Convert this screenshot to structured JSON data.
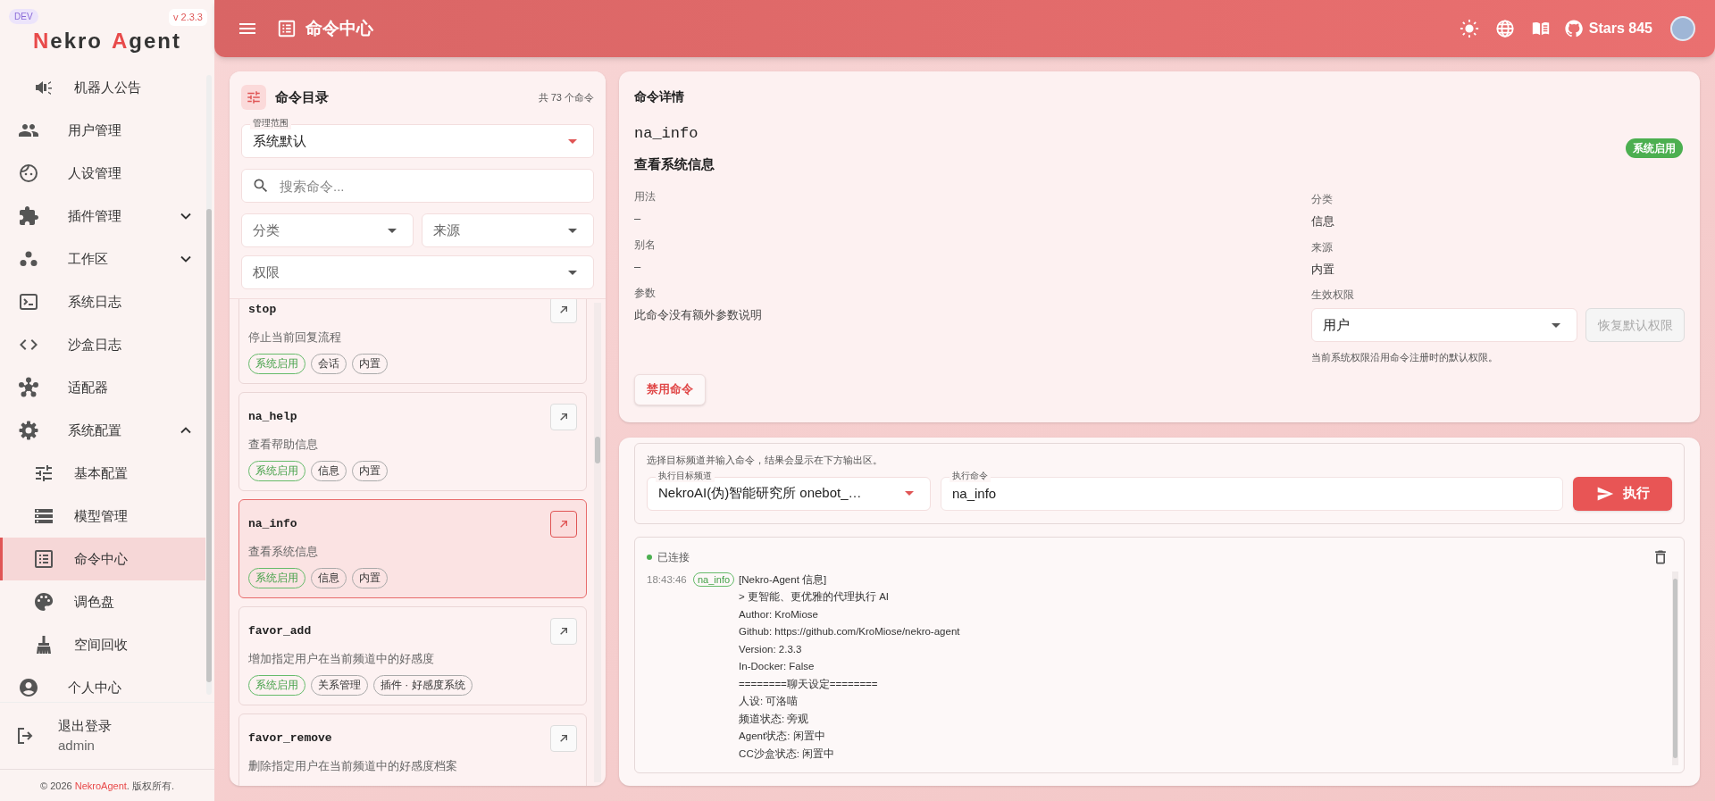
{
  "sidebar": {
    "dev_badge": "DEV",
    "version": "v 2.3.3",
    "logo": [
      {
        "text": "N",
        "accent": true
      },
      {
        "text": "ekro",
        "accent": false
      },
      {
        "text": "A",
        "accent": true
      },
      {
        "text": "gent",
        "accent": false
      }
    ],
    "items": [
      {
        "children": [
          {
            "label": "机器人公告",
            "selected": false
          }
        ]
      },
      {
        "label": "用户管理",
        "selected": false
      },
      {
        "label": "人设管理",
        "selected": false
      },
      {
        "label": "插件管理",
        "selected": false,
        "expanded": false
      },
      {
        "label": "工作区",
        "selected": false,
        "expanded": false
      },
      {
        "label": "系统日志",
        "selected": false
      },
      {
        "label": "沙盒日志",
        "selected": false
      },
      {
        "label": "适配器",
        "selected": false
      },
      {
        "label": "系统配置",
        "selected": false,
        "expanded": true,
        "children": [
          {
            "label": "基本配置",
            "selected": false
          },
          {
            "label": "模型管理",
            "selected": false
          },
          {
            "label": "命令中心",
            "selected": true
          },
          {
            "label": "调色盘",
            "selected": false
          },
          {
            "label": "空间回收",
            "selected": false
          }
        ]
      },
      {
        "label": "个人中心",
        "selected": false
      }
    ],
    "logout": {
      "label": "退出登录",
      "user": "admin"
    },
    "footer": {
      "prefix": "© 2026 ",
      "link": "NekroAgent",
      "suffix": ". 版权所有."
    }
  },
  "header": {
    "title": "命令中心",
    "stars": "Stars 845"
  },
  "catalog": {
    "title": "命令目录",
    "count": "共 73 个命令",
    "scope": {
      "label": "管理范围",
      "value": "系统默认"
    },
    "search": {
      "placeholder": "搜索命令..."
    },
    "filters": [
      {
        "placeholder": "分类"
      },
      {
        "placeholder": "来源"
      },
      {
        "placeholder": "权限"
      }
    ],
    "commands": [
      {
        "name": "stop",
        "description": "停止当前回复流程",
        "selected": false,
        "tags": [
          {
            "label": "系统启用",
            "kind": "status"
          },
          {
            "label": "会话",
            "kind": "meta"
          },
          {
            "label": "内置",
            "kind": "meta"
          }
        ]
      },
      {
        "name": "na_help",
        "description": "查看帮助信息",
        "selected": false,
        "tags": [
          {
            "label": "系统启用",
            "kind": "status"
          },
          {
            "label": "信息",
            "kind": "meta"
          },
          {
            "label": "内置",
            "kind": "meta"
          }
        ]
      },
      {
        "name": "na_info",
        "description": "查看系统信息",
        "selected": true,
        "tags": [
          {
            "label": "系统启用",
            "kind": "status"
          },
          {
            "label": "信息",
            "kind": "meta"
          },
          {
            "label": "内置",
            "kind": "meta"
          }
        ]
      },
      {
        "name": "favor_add",
        "description": "增加指定用户在当前频道中的好感度",
        "selected": false,
        "tags": [
          {
            "label": "系统启用",
            "kind": "status"
          },
          {
            "label": "关系管理",
            "kind": "meta"
          },
          {
            "label": "插件 · 好感度系统",
            "kind": "meta"
          }
        ]
      },
      {
        "name": "favor_remove",
        "description": "删除指定用户在当前频道中的好感度档案",
        "selected": false
      }
    ]
  },
  "detail": {
    "title": "命令详情",
    "name": "na_info",
    "description": "查看系统信息",
    "status_badge": "系统启用",
    "fields_left": [
      {
        "label": "用法",
        "value": "–"
      },
      {
        "label": "别名",
        "value": "–"
      },
      {
        "label": "参数",
        "value": "此命令没有额外参数说明"
      }
    ],
    "fields_right": [
      {
        "label": "分类",
        "value": "信息"
      },
      {
        "label": "来源",
        "value": "内置"
      }
    ],
    "permission": {
      "label": "生效权限",
      "value": "用户"
    },
    "reset_button": {
      "label": "恢复默认权限",
      "disabled": true
    },
    "hint": "当前系统权限沿用命令注册时的默认权限。",
    "disable_button": "禁用命令"
  },
  "console": {
    "hint": "选择目标频道并输入命令，结果会显示在下方输出区。",
    "channel": {
      "label": "执行目标频道",
      "value": "NekroAI(伪)智能研究所 onebot_…"
    },
    "command": {
      "label": "执行命令",
      "value": "na_info"
    },
    "run_button": "执行",
    "status": "已连接",
    "connected": true,
    "log": [
      {
        "time": "18:43:46",
        "tag": "na_info",
        "lines": [
          "[Nekro-Agent 信息]",
          "> 更智能、更优雅的代理执行 AI",
          "Author: KroMiose",
          "Github: https://github.com/KroMiose/nekro-agent",
          "Version: 2.3.3",
          "In-Docker: False",
          "========聊天设定========",
          "人设: 可洛喵",
          "频道状态: 旁观",
          "Agent状态: 闲置中",
          "CC沙盒状态: 闲置中"
        ]
      }
    ]
  }
}
